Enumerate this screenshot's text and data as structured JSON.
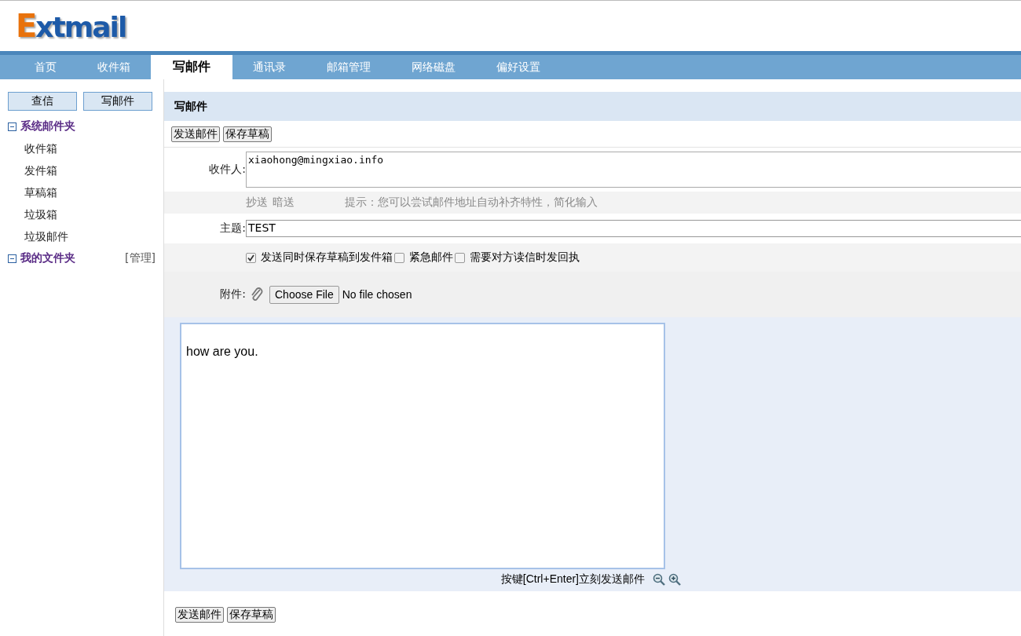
{
  "logo": "Extmail",
  "nav": [
    {
      "label": "首页",
      "selected": false
    },
    {
      "label": "收件箱",
      "selected": false
    },
    {
      "label": "写邮件",
      "selected": true
    },
    {
      "label": "通讯录",
      "selected": false
    },
    {
      "label": "邮箱管理",
      "selected": false
    },
    {
      "label": "网络磁盘",
      "selected": false
    },
    {
      "label": "偏好设置",
      "selected": false
    }
  ],
  "sidebar": {
    "buttons": [
      "查信",
      "写邮件"
    ],
    "folders": [
      {
        "label": "系统邮件夹",
        "expanded": true,
        "children": [
          {
            "label": "收件箱"
          },
          {
            "label": "发件箱"
          },
          {
            "label": "草稿箱"
          },
          {
            "label": "垃圾箱"
          },
          {
            "label": "垃圾邮件"
          }
        ]
      },
      {
        "label": "我的文件夹",
        "expanded": true,
        "manage": "[管理]"
      }
    ]
  },
  "compose": {
    "title": "写邮件",
    "top_buttons": [
      "发送邮件",
      "保存草稿"
    ],
    "to_label": "收件人:",
    "to_value": "xiaohong@mingxiao.info",
    "cc": "抄送",
    "bcc": "暗送",
    "tip": "提示：您可以尝试邮件地址自动补齐特性，简化输入",
    "subject_label": "主题:",
    "subject_value": "TEST",
    "options": [
      {
        "label": "发送同时保存草稿到发件箱",
        "checked": true
      },
      {
        "label": "紧急邮件",
        "checked": false
      },
      {
        "label": "需要对方读信时发回执",
        "checked": false
      }
    ],
    "attach_label": "附件:",
    "file_button": "Choose File",
    "file_status": "No file chosen",
    "body": "how are you.",
    "shortcut_hint": "按键[Ctrl+Enter]立刻发送邮件",
    "bottom_buttons": [
      "发送邮件",
      "保存草稿"
    ]
  }
}
